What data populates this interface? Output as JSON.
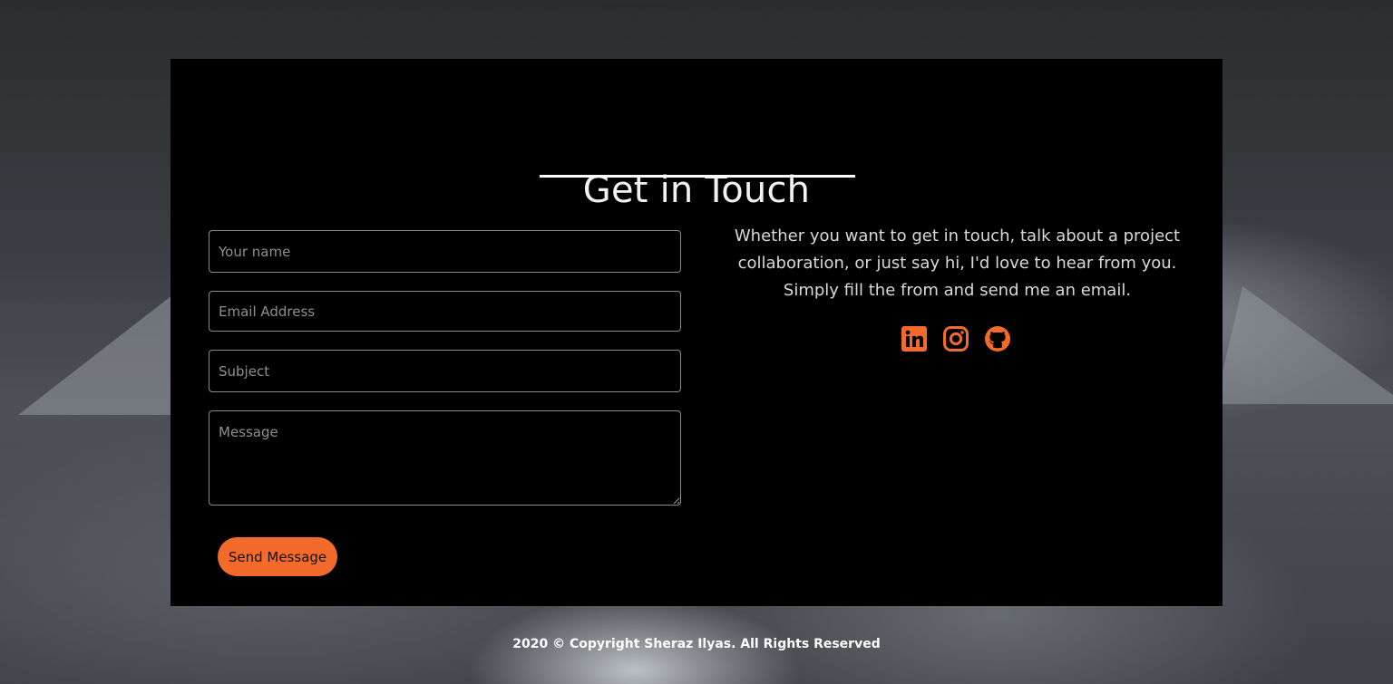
{
  "contact": {
    "title": "Get in Touch",
    "form": {
      "name_placeholder": "Your name",
      "email_placeholder": "Email Address",
      "subject_placeholder": "Subject",
      "message_placeholder": "Message",
      "submit_label": "Send Message"
    },
    "intro_lines": [
      "Whether you want to get in touch, talk about a project",
      "collaboration, or just say hi, I'd love to hear from you.",
      "Simply fill the from and send me an email."
    ],
    "socials": [
      {
        "icon": "linkedin-icon"
      },
      {
        "icon": "instagram-icon"
      },
      {
        "icon": "github-icon"
      }
    ]
  },
  "footer": {
    "text": "2020 © Copyright Sheraz Ilyas. All Rights Reserved"
  },
  "colors": {
    "accent": "#f36a2a",
    "card_background": "#000000",
    "text": "#d9d9d9"
  }
}
